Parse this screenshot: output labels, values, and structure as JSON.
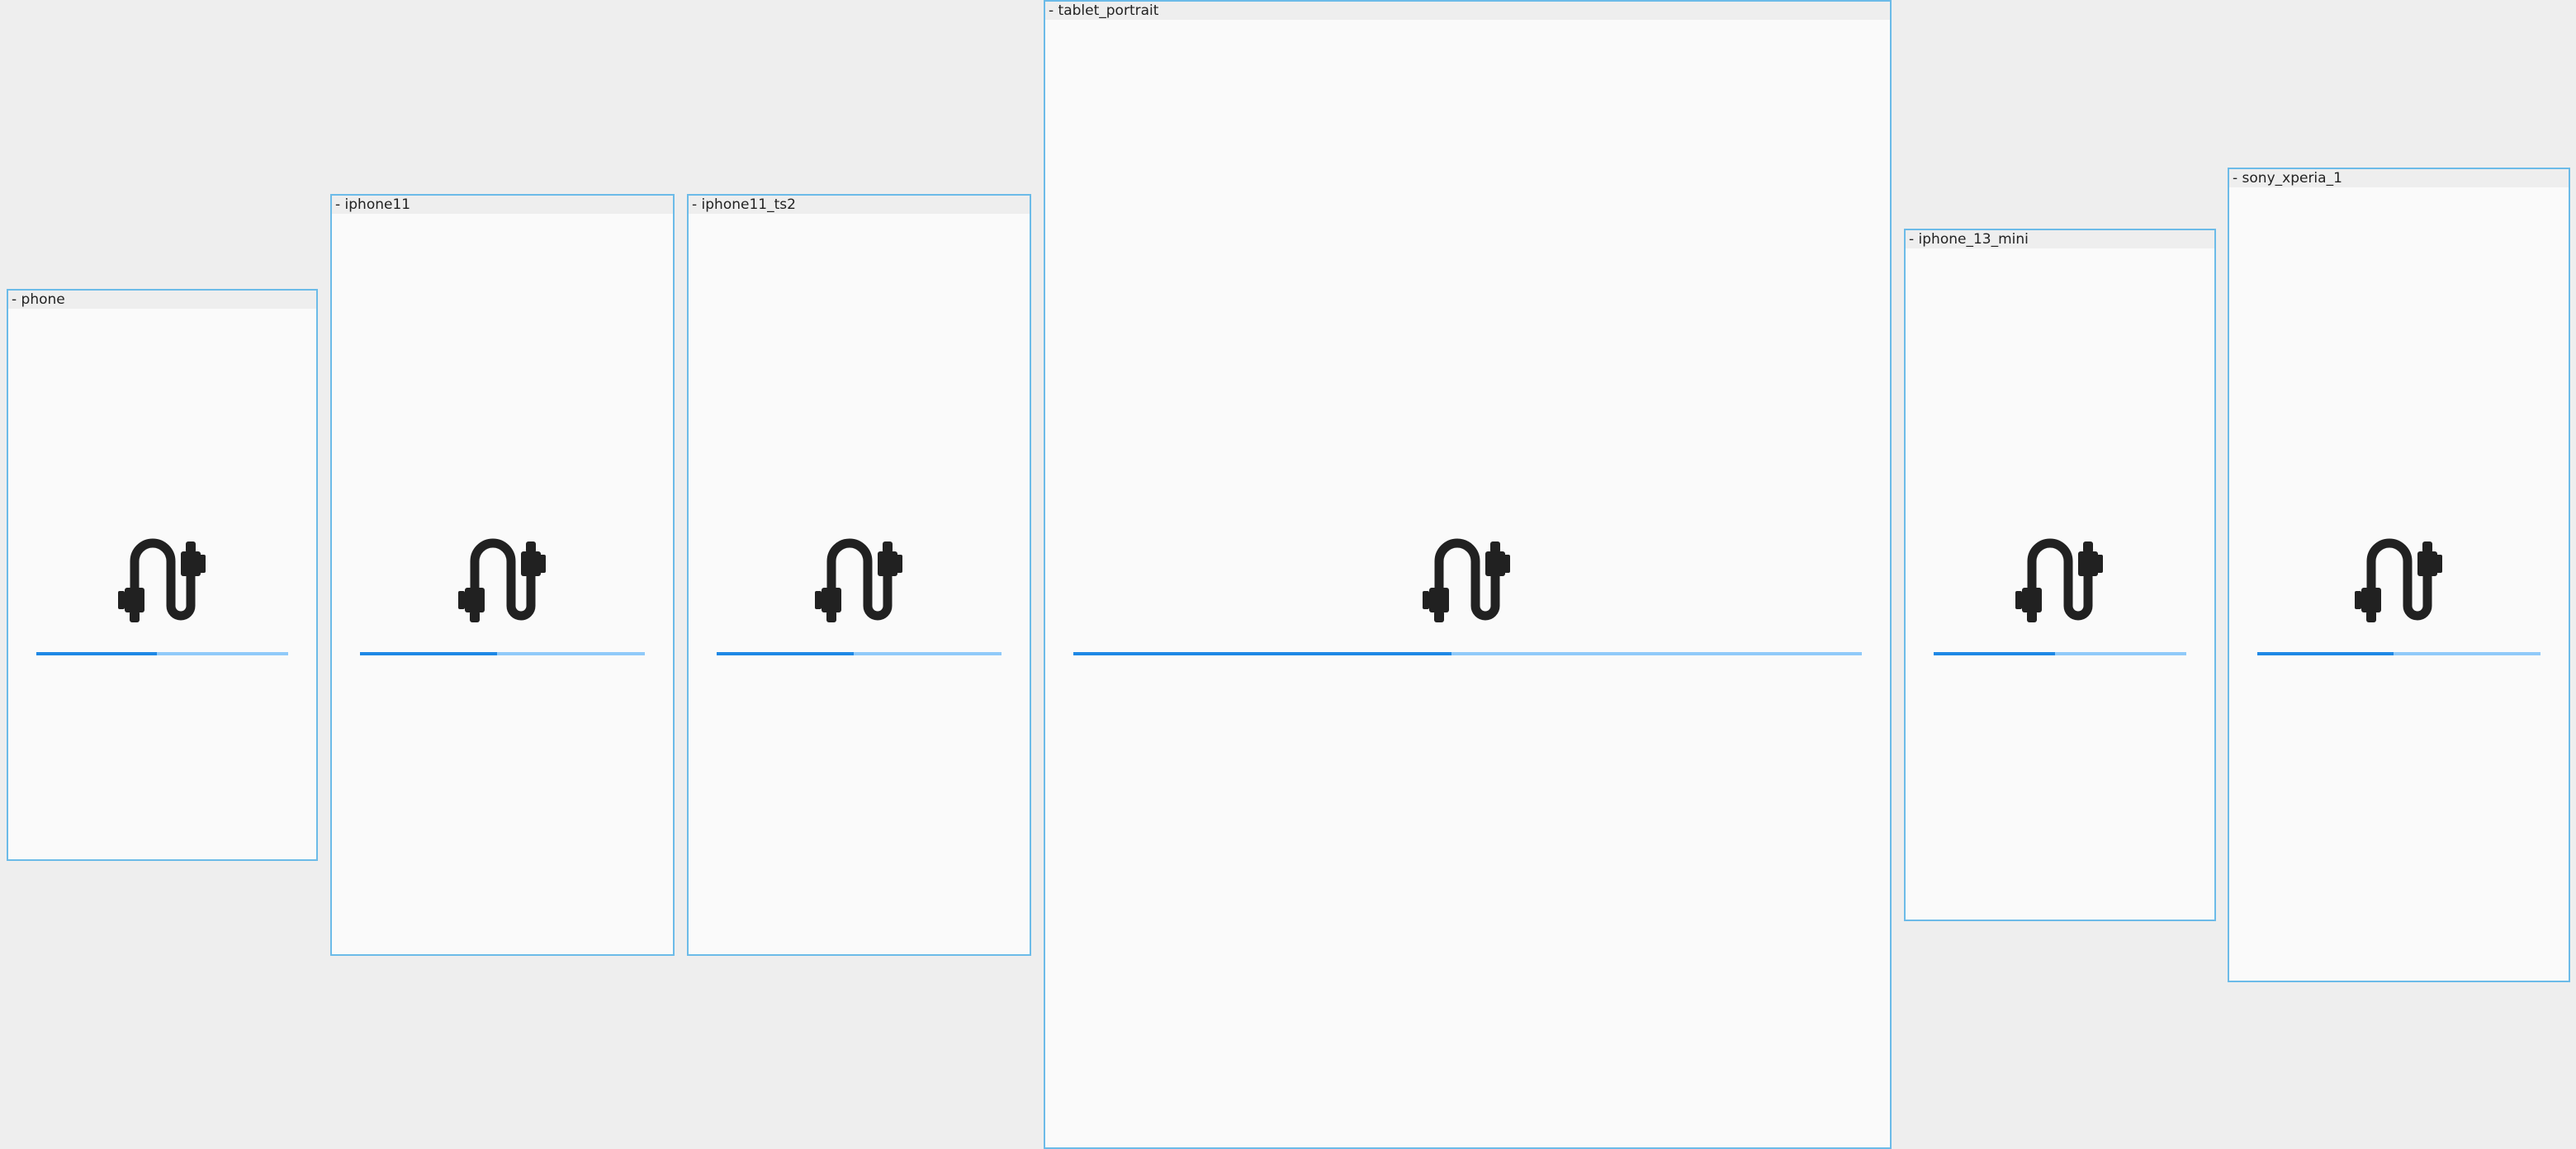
{
  "frames": [
    {
      "label": "- phone",
      "progress": 0.48
    },
    {
      "label": "- iphone11",
      "progress": 0.48
    },
    {
      "label": "- iphone11_ts2",
      "progress": 0.48
    },
    {
      "label": "- tablet_portrait",
      "progress": 0.48
    },
    {
      "label": "- iphone_13_mini",
      "progress": 0.48
    },
    {
      "label": "- sony_xperia_1",
      "progress": 0.48
    }
  ],
  "icon": "cable-plug-icon",
  "colors": {
    "frame_border": "#6cbbe8",
    "progress_fill": "#1e88e5",
    "progress_track": "#90caf9",
    "icon": "#212121"
  }
}
